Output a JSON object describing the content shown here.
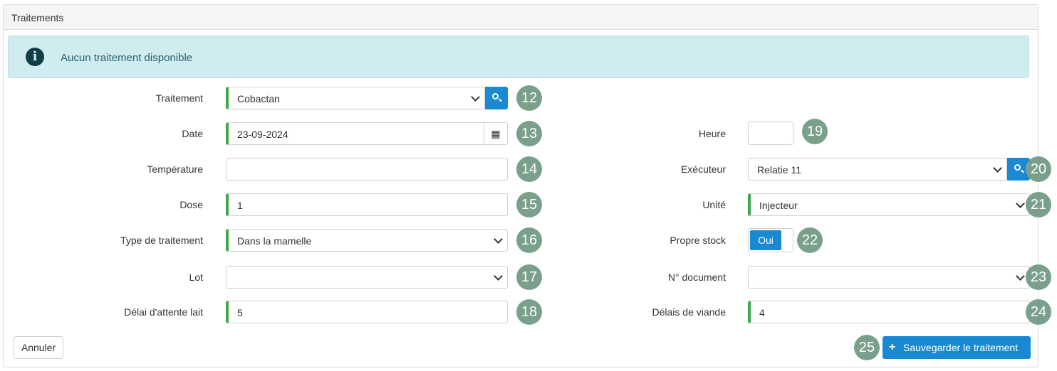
{
  "panel": {
    "title": "Traitements"
  },
  "alert": {
    "icon": "info-circle-icon",
    "text": "Aucun traitement disponible"
  },
  "form": {
    "traitement": {
      "label": "Traitement",
      "value": "Cobactan",
      "badge": "12"
    },
    "date": {
      "label": "Date",
      "value": "23-09-2024",
      "badge": "13",
      "icon": "calendar-icon"
    },
    "temperature": {
      "label": "Température",
      "value": "",
      "badge": "14"
    },
    "dose": {
      "label": "Dose",
      "value": "1",
      "badge": "15"
    },
    "type": {
      "label": "Type de traitement",
      "value": "Dans la mamelle",
      "badge": "16"
    },
    "lot": {
      "label": "Lot",
      "value": "",
      "badge": "17"
    },
    "delai_lait": {
      "label": "Délai d'attente lait",
      "value": "5",
      "badge": "18"
    },
    "heure": {
      "label": "Heure",
      "value": "",
      "badge": "19"
    },
    "executeur": {
      "label": "Exécuteur",
      "value": "Relatie 11",
      "badge": "20"
    },
    "unite": {
      "label": "Unité",
      "value": "Injecteur",
      "badge": "21"
    },
    "propre_stock": {
      "label": "Propre stock",
      "value": "Oui",
      "badge": "22"
    },
    "document": {
      "label": "N° document",
      "value": "",
      "badge": "23"
    },
    "delai_viande": {
      "label": "Délais de viande",
      "value": "4",
      "badge": "24"
    }
  },
  "actions": {
    "cancel_label": "Annuler",
    "save_label": "Sauvegarder le traitement",
    "save_badge": "25",
    "save_icon": "plus-icon"
  },
  "colors": {
    "accent": "#1a89d4",
    "required": "#3fa64d",
    "badge": "#7aa08c",
    "alert_bg": "#d1ecf0"
  }
}
